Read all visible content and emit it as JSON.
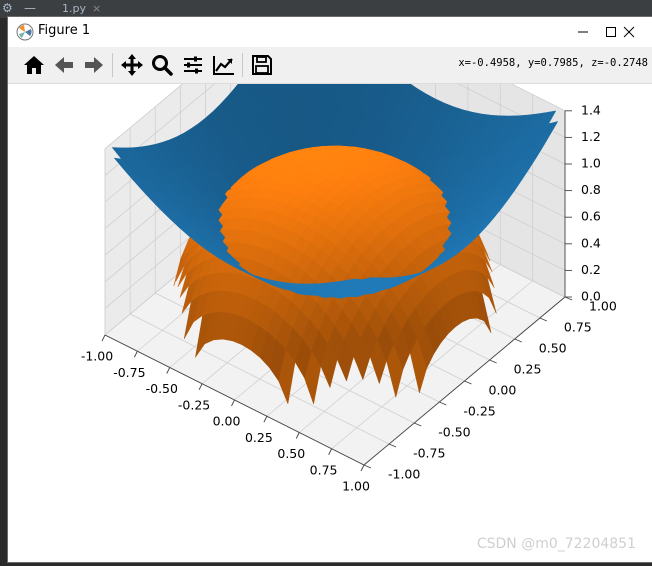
{
  "ide": {
    "tab_label": "1.py",
    "close_glyph": "×",
    "gear_glyph": "⚙",
    "dash_glyph": "—"
  },
  "window": {
    "title": "Figure 1",
    "minimize_glyph": "—",
    "maximize_glyph": "☐",
    "close_glyph": "✕"
  },
  "toolbar": {
    "buttons": [
      "home-icon",
      "back-arrow-icon",
      "forward-arrow-icon",
      "pan-icon",
      "zoom-icon",
      "subplots-icon",
      "customize-icon",
      "save-icon"
    ],
    "coords_readout": "x=-0.4958, y=0.7985, z=-0.2748"
  },
  "watermark": "CSDN @m0_72204851",
  "chart_data": {
    "type": "surface3d",
    "title": "",
    "surfaces": [
      {
        "formula": "z = sqrt(x^2 + y^2)",
        "color": "#1f77b4"
      },
      {
        "formula": "z = sqrt(1 - x^2 - y^2)",
        "color": "#ff7f0e"
      }
    ],
    "x_ticks": [
      "-1.00",
      "-0.75",
      "-0.50",
      "-0.25",
      "0.00",
      "0.25",
      "0.50",
      "0.75",
      "1.00"
    ],
    "y_ticks": [
      "-1.00",
      "-0.75",
      "-0.50",
      "-0.25",
      "0.00",
      "0.25",
      "0.50",
      "0.75",
      "1.00"
    ],
    "z_ticks": [
      "0.0",
      "0.2",
      "0.4",
      "0.6",
      "0.8",
      "1.0",
      "1.2",
      "1.4"
    ],
    "xlim": [
      -1,
      1
    ],
    "ylim": [
      -1,
      1
    ],
    "zlim": [
      0,
      1.4
    ],
    "grid": true
  }
}
